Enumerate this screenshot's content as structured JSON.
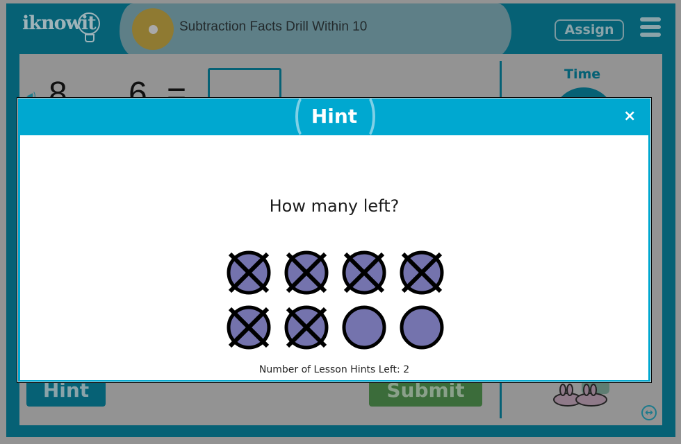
{
  "header": {
    "logo_text": "iknowit",
    "lesson_title": "Subtraction Facts Drill Within 10",
    "assign_label": "Assign",
    "menu_icon": "hamburger-menu-icon"
  },
  "problem": {
    "minuend": "8",
    "operator": "−",
    "subtrahend": "6",
    "equals": "=",
    "answer_value": ""
  },
  "sidebar": {
    "time_label": "Time"
  },
  "footer": {
    "hint_label": "Hint",
    "submit_label": "Submit"
  },
  "modal": {
    "title": "Hint",
    "close_label": "×",
    "question": "How many left?",
    "total_counters": 8,
    "crossed_out": 6,
    "counter_color": "#7473ad",
    "hints_left_text": "Number of Lesson Hints Left: 2"
  },
  "colors": {
    "frame": "#066175",
    "modal_header": "#00a8d0",
    "overlay": "#939393"
  }
}
